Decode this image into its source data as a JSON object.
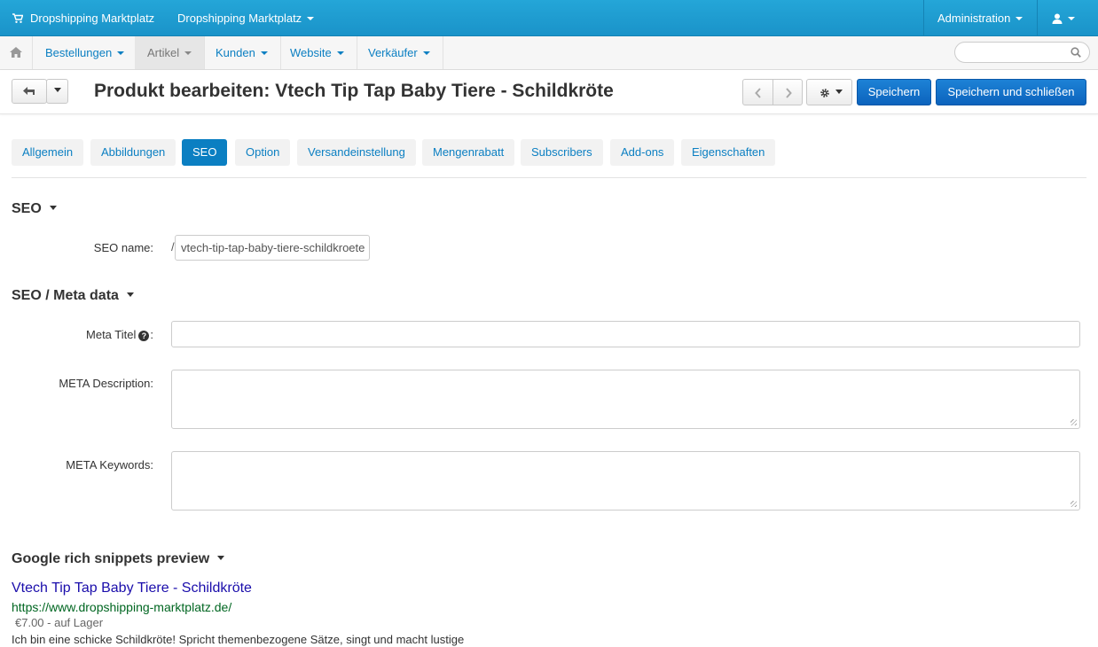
{
  "topbar": {
    "brand": "Dropshipping Marktplatz",
    "store_selector": "Dropshipping Marktplatz",
    "administration": "Administration"
  },
  "nav": {
    "items": [
      {
        "label": "Bestellungen"
      },
      {
        "label": "Artikel"
      },
      {
        "label": "Kunden"
      },
      {
        "label": "Website"
      },
      {
        "label": "Verkäufer"
      }
    ],
    "search_placeholder": ""
  },
  "toolbar": {
    "title": "Produkt bearbeiten: Vtech Tip Tap Baby Tiere - Schildkröte",
    "save": "Speichern",
    "save_close": "Speichern und schließen"
  },
  "tabs": [
    {
      "label": "Allgemein"
    },
    {
      "label": "Abbildungen"
    },
    {
      "label": "SEO",
      "active": true
    },
    {
      "label": "Option"
    },
    {
      "label": "Versandeinstellung"
    },
    {
      "label": "Mengenrabatt"
    },
    {
      "label": "Subscribers"
    },
    {
      "label": "Add-ons"
    },
    {
      "label": "Eigenschaften"
    }
  ],
  "seo": {
    "heading": "SEO",
    "name_label": "SEO name:",
    "name_prefix": "/",
    "name_value": "vtech-tip-tap-baby-tiere-schildkroete"
  },
  "meta": {
    "heading": "SEO / Meta data",
    "title_label": "Meta Titel",
    "title_label_suffix": ":",
    "title_value": "",
    "description_label": "META Description:",
    "description_value": "",
    "keywords_label": "META Keywords:",
    "keywords_value": ""
  },
  "snippet": {
    "heading": "Google rich snippets preview",
    "title": "Vtech Tip Tap Baby Tiere - Schildkröte",
    "url": "https://www.dropshipping-marktplatz.de/",
    "price": "€7.00 - auf Lager",
    "description": "Ich bin eine schicke Schildkröte! Spricht themenbezogene Sätze, singt und macht lustige"
  },
  "colors": {
    "topbar": "#1a93c9",
    "link": "#0b7fc2",
    "primary_button": "#0c63bd",
    "snippet_title": "#1a0dab",
    "snippet_url": "#006621"
  }
}
